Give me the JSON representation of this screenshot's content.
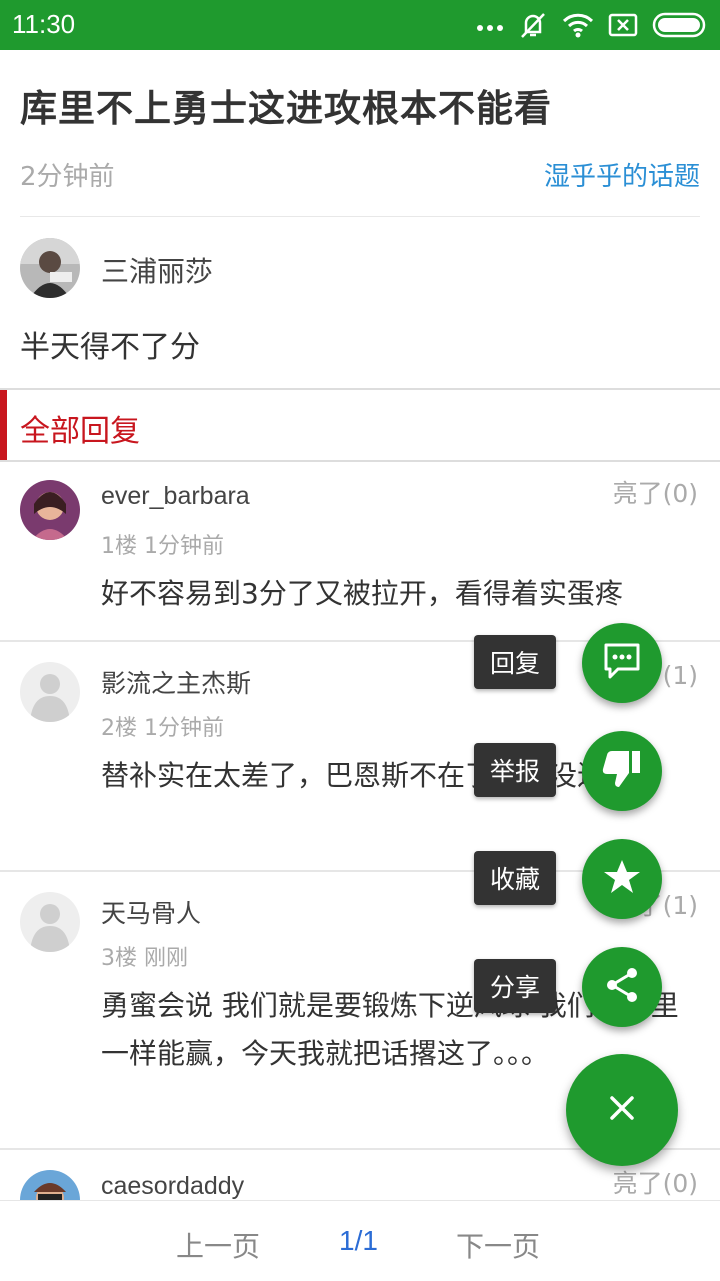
{
  "status_bar": {
    "time": "11:30"
  },
  "post": {
    "title": "库里不上勇士这进攻根本不能看",
    "time": "2分钟前",
    "topic": "湿乎乎的话题",
    "author": "三浦丽莎",
    "content": "半天得不了分"
  },
  "replies_header": "全部回复",
  "replies": [
    {
      "name": "ever_barbara",
      "meta": "1楼 1分钟前",
      "likes": "亮了(0)",
      "text": "好不容易到3分了又被拉开，看得着实蛋疼"
    },
    {
      "name": "影流之主杰斯",
      "meta": "2楼 1分钟前",
      "likes": "亮了(1)",
      "text": "替补实在太差了，巴恩斯不在了完全没进攻了"
    },
    {
      "name": "天马骨人",
      "meta": "3楼 刚刚",
      "likes": "亮了(1)",
      "text": "勇蜜会说 我们就是要锻炼下逆风球 我们没库里一样能赢，今天我就把话撂这了。。。"
    },
    {
      "name": "caesordaddy",
      "meta": "",
      "likes": "亮了(0)",
      "text": ""
    }
  ],
  "pager": {
    "prev": "上一页",
    "page": "1/1",
    "next": "下一页"
  },
  "fab_menu": {
    "reply": "回复",
    "report": "举报",
    "favorite": "收藏",
    "share": "分享"
  },
  "colors": {
    "accent": "#1f9a2e",
    "section_red": "#c8161e",
    "link_blue": "#2b8fd5"
  }
}
